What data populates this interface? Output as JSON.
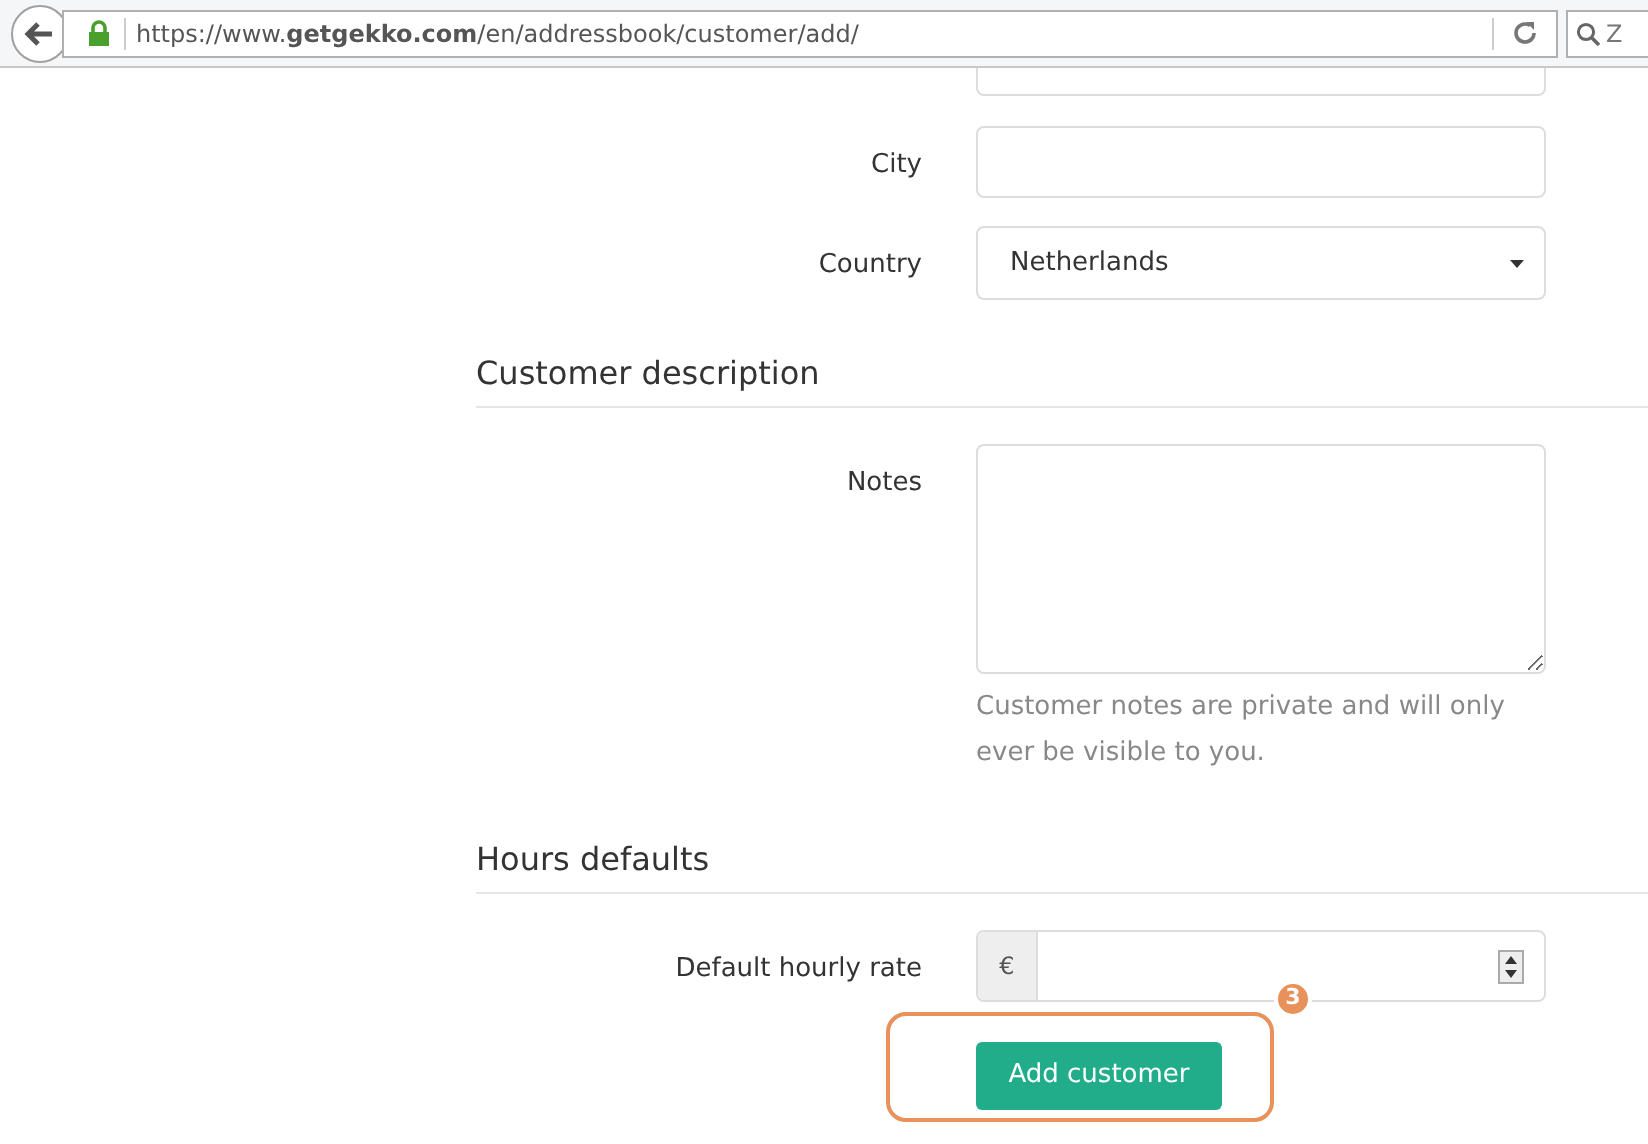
{
  "browser": {
    "url": "https://www.**getgekko.com**/en/addressbook/customer/add/",
    "search": {
      "placeholder": "Z"
    }
  },
  "sections": [
    {
      "fields": [
        {
          "kind": "text",
          "label": "City"
        },
        {
          "kind": "select",
          "label": "Country",
          "value": "Netherlands"
        }
      ]
    },
    {
      "heading": "Customer description",
      "fields": [
        {
          "kind": "textarea",
          "label": "Notes",
          "help": "Customer notes are private and will only ever be visible to you."
        }
      ]
    },
    {
      "heading": "Hours defaults",
      "fields": [
        {
          "kind": "currency",
          "label": "Default hourly rate",
          "prefix": "€"
        }
      ]
    }
  ],
  "submit": {
    "label": "Add customer",
    "callout": "3"
  }
}
